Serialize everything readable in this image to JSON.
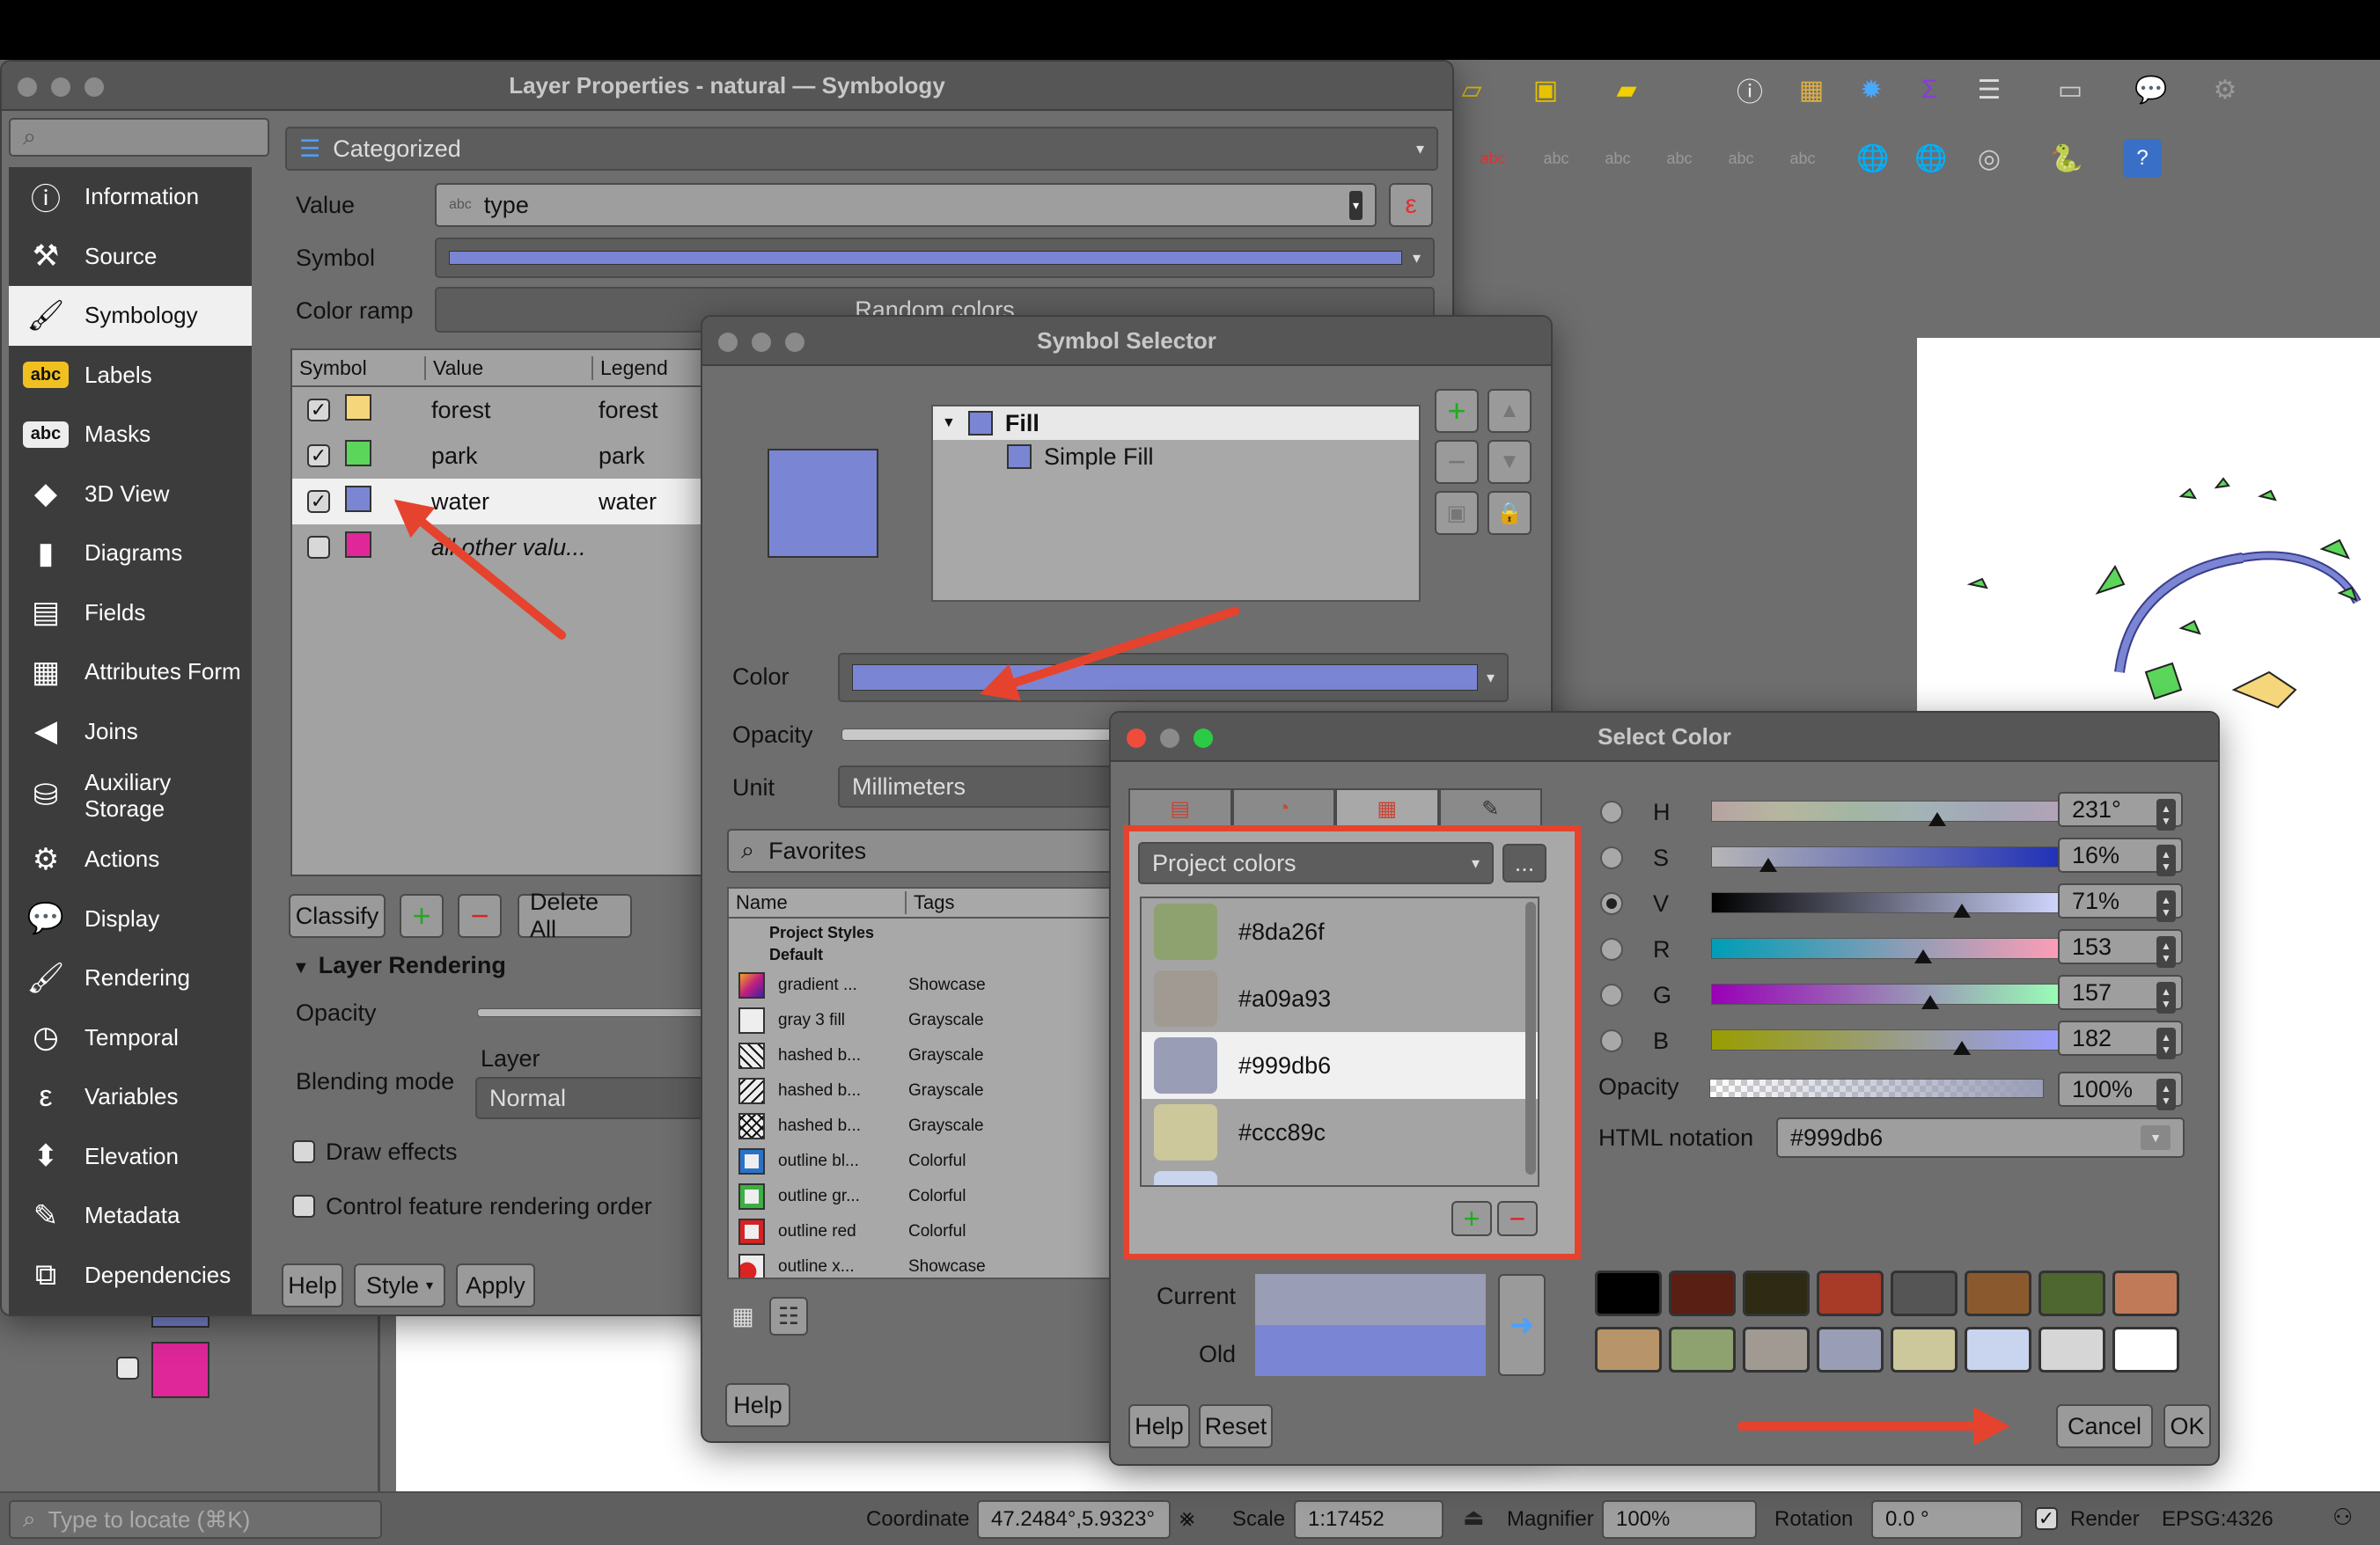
{
  "layer_props": {
    "title": "Layer Properties - natural — Symbology",
    "renderer": "Categorized",
    "value_label": "Value",
    "value_field": "type",
    "value_badge": "abc",
    "symbol_label": "Symbol",
    "color_ramp_label": "Color ramp",
    "color_ramp_value": "Random colors",
    "table_headers": [
      "Symbol",
      "Value",
      "Legend"
    ],
    "categories": [
      {
        "value": "forest",
        "legend": "forest",
        "color": "#f5d67a",
        "checked": true
      },
      {
        "value": "park",
        "legend": "park",
        "color": "#5bd65b",
        "checked": true
      },
      {
        "value": "water",
        "legend": "water",
        "color": "#7a86d3",
        "checked": true
      },
      {
        "value": "all other valu...",
        "legend": "",
        "color": "#e0279a",
        "checked": false
      }
    ],
    "classify": "Classify",
    "delete_all": "Delete All",
    "layer_rendering": "Layer Rendering",
    "opacity": "Opacity",
    "blending_mode": "Blending mode",
    "layer_sub": "Layer",
    "blend_value": "Normal",
    "draw_effects": "Draw effects",
    "control_order": "Control feature rendering order",
    "help": "Help",
    "style": "Style",
    "apply": "Apply",
    "sidebar": [
      {
        "label": "Information",
        "icon": "information-icon"
      },
      {
        "label": "Source",
        "icon": "source-icon"
      },
      {
        "label": "Symbology",
        "icon": "symbology-icon"
      },
      {
        "label": "Labels",
        "icon": "labels-icon"
      },
      {
        "label": "Masks",
        "icon": "masks-icon"
      },
      {
        "label": "3D View",
        "icon": "3d-view-icon"
      },
      {
        "label": "Diagrams",
        "icon": "diagrams-icon"
      },
      {
        "label": "Fields",
        "icon": "fields-icon"
      },
      {
        "label": "Attributes Form",
        "icon": "attributes-form-icon"
      },
      {
        "label": "Joins",
        "icon": "joins-icon"
      },
      {
        "label": "Auxiliary Storage",
        "icon": "auxiliary-storage-icon"
      },
      {
        "label": "Actions",
        "icon": "actions-icon"
      },
      {
        "label": "Display",
        "icon": "display-icon"
      },
      {
        "label": "Rendering",
        "icon": "rendering-icon"
      },
      {
        "label": "Temporal",
        "icon": "temporal-icon"
      },
      {
        "label": "Variables",
        "icon": "variables-icon"
      },
      {
        "label": "Elevation",
        "icon": "elevation-icon"
      },
      {
        "label": "Metadata",
        "icon": "metadata-icon"
      },
      {
        "label": "Dependencies",
        "icon": "dependencies-icon"
      }
    ],
    "label_icon_text": "abc",
    "mask_icon_text": "abc"
  },
  "symbol_selector": {
    "title": "Symbol Selector",
    "tree_fill": "Fill",
    "tree_simple_fill": "Simple Fill",
    "color_label": "Color",
    "opacity_label": "Opacity",
    "unit_label": "Unit",
    "unit_value": "Millimeters",
    "search_value": "Favorites",
    "list_headers": [
      "Name",
      "Tags"
    ],
    "group_project": "Project Styles",
    "group_default": "Default",
    "styles": [
      {
        "name": "gradient ...",
        "tag": "Showcase"
      },
      {
        "name": "gray 3 fill",
        "tag": "Grayscale"
      },
      {
        "name": "hashed b...",
        "tag": "Grayscale"
      },
      {
        "name": "hashed b...",
        "tag": "Grayscale"
      },
      {
        "name": "hashed b...",
        "tag": "Grayscale"
      },
      {
        "name": "outline bl...",
        "tag": "Colorful"
      },
      {
        "name": "outline gr...",
        "tag": "Colorful"
      },
      {
        "name": "outline red",
        "tag": "Colorful"
      },
      {
        "name": "outline x...",
        "tag": "Showcase"
      }
    ],
    "help": "Help",
    "fill_color": "#7a86d3"
  },
  "select_color": {
    "title": "Select Color",
    "palette_name": "Project colors",
    "more": "...",
    "palette": [
      {
        "hex": "#8da26f"
      },
      {
        "hex": "#a09a93"
      },
      {
        "hex": "#999db6"
      },
      {
        "hex": "#ccc89c"
      }
    ],
    "channels": [
      {
        "label": "H",
        "value": "231°"
      },
      {
        "label": "S",
        "value": "16%"
      },
      {
        "label": "V",
        "value": "71%"
      },
      {
        "label": "R",
        "value": "153"
      },
      {
        "label": "G",
        "value": "157"
      },
      {
        "label": "B",
        "value": "182"
      }
    ],
    "opacity_label": "Opacity",
    "opacity_value": "100%",
    "html_label": "HTML notation",
    "html_value": "#999db6",
    "current_label": "Current",
    "old_label": "Old",
    "current_color": "#999db6",
    "old_color": "#7a86d3",
    "swatches": [
      "#000000",
      "#5a1f14",
      "#2e2a14",
      "#a83a28",
      "#555555",
      "#8a5a2e",
      "#4e6630",
      "#c07a58",
      "#b8946a",
      "#8da26f",
      "#a09a93",
      "#999db6",
      "#ccc89c",
      "#c9d4ee",
      "#d6d6d6",
      "#ffffff"
    ],
    "help": "Help",
    "reset": "Reset",
    "cancel": "Cancel",
    "ok": "OK"
  },
  "status": {
    "locate_placeholder": "Type to locate (⌘K)",
    "coordinate_label": "Coordinate",
    "coordinate_value": "47.2484°,5.9323°",
    "scale_label": "Scale",
    "scale_value": "1:17452",
    "magnifier_label": "Magnifier",
    "magnifier_value": "100%",
    "rotation_label": "Rotation",
    "rotation_value": "0.0 °",
    "render_label": "Render",
    "crs_value": "EPSG:4326"
  }
}
